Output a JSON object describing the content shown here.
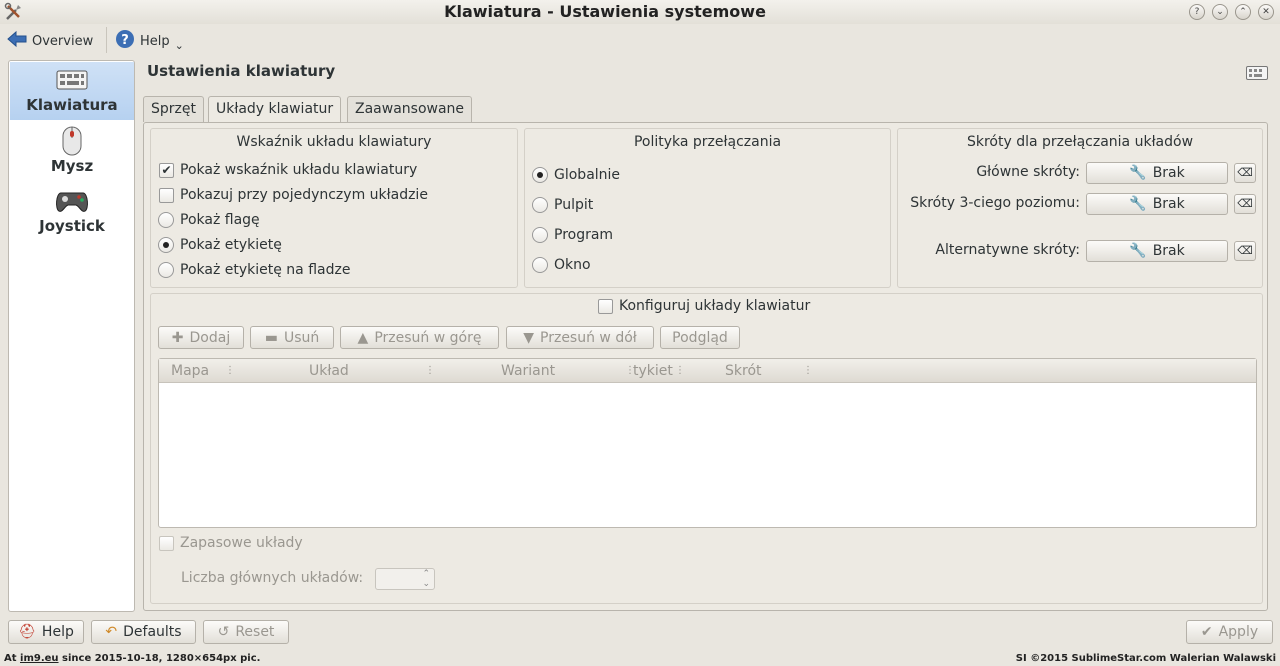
{
  "window": {
    "title": "Klawiatura - Ustawienia systemowe",
    "buttons": [
      "?",
      "⌄",
      "⌃",
      "✕"
    ]
  },
  "toolbar": {
    "overview": "Overview",
    "help": "Help",
    "help_arrow": "⌄"
  },
  "sidebar": {
    "items": [
      {
        "label": "Klawiatura",
        "icon": "keyboard-icon",
        "selected": true
      },
      {
        "label": "Mysz",
        "icon": "mouse-icon",
        "selected": false
      },
      {
        "label": "Joystick",
        "icon": "gamepad-icon",
        "selected": false
      }
    ]
  },
  "page": {
    "title": "Ustawienia klawiatury"
  },
  "tabs": [
    {
      "label": "Sprzęt",
      "active": false
    },
    {
      "label": "Układy klawiatur",
      "active": true
    },
    {
      "label": "Zaawansowane",
      "active": false
    }
  ],
  "indicator": {
    "title": "Wskaźnik układu klawiatury",
    "options": [
      {
        "label": "Pokaż wskaźnik układu klawiatury",
        "type": "checkbox",
        "checked": true
      },
      {
        "label": "Pokazuj przy pojedynczym układzie",
        "type": "checkbox",
        "checked": false
      },
      {
        "label": "Pokaż flagę",
        "type": "radio",
        "checked": false
      },
      {
        "label": "Pokaż etykietę",
        "type": "radio",
        "checked": true
      },
      {
        "label": "Pokaż etykietę na fladze",
        "type": "radio",
        "checked": false
      }
    ]
  },
  "policy": {
    "title": "Polityka przełączania",
    "options": [
      {
        "label": "Globalnie",
        "checked": true
      },
      {
        "label": "Pulpit",
        "checked": false
      },
      {
        "label": "Program",
        "checked": false
      },
      {
        "label": "Okno",
        "checked": false
      }
    ]
  },
  "shortcuts": {
    "title": "Skróty dla przełączania układów",
    "rows": [
      {
        "label": "Główne skróty:",
        "value": "Brak"
      },
      {
        "label": "Skróty 3-ciego poziomu:",
        "value": "Brak"
      },
      {
        "label": "Alternatywne skróty:",
        "value": "Brak"
      }
    ]
  },
  "layouts": {
    "configure": "Konfiguruj układy klawiatur",
    "buttons": {
      "add": "Dodaj",
      "remove": "Usuń",
      "up": "Przesuń w górę",
      "down": "Przesuń w dół",
      "preview": "Podgląd"
    },
    "columns": [
      "Mapa",
      "Układ",
      "Wariant",
      "tykiet",
      "Skrót"
    ],
    "spare": "Zapasowe układy",
    "count_label": "Liczba głównych układów:"
  },
  "bottom": {
    "help": "Help",
    "defaults": "Defaults",
    "reset": "Reset",
    "apply": "Apply"
  },
  "status": {
    "left_prefix": "At ",
    "left_site": "im9.eu",
    "left_rest": " since 2015-10-18, 1280×654px pic.",
    "right": "SI ©2015 SublimeStar.com Walerian Walawski"
  }
}
